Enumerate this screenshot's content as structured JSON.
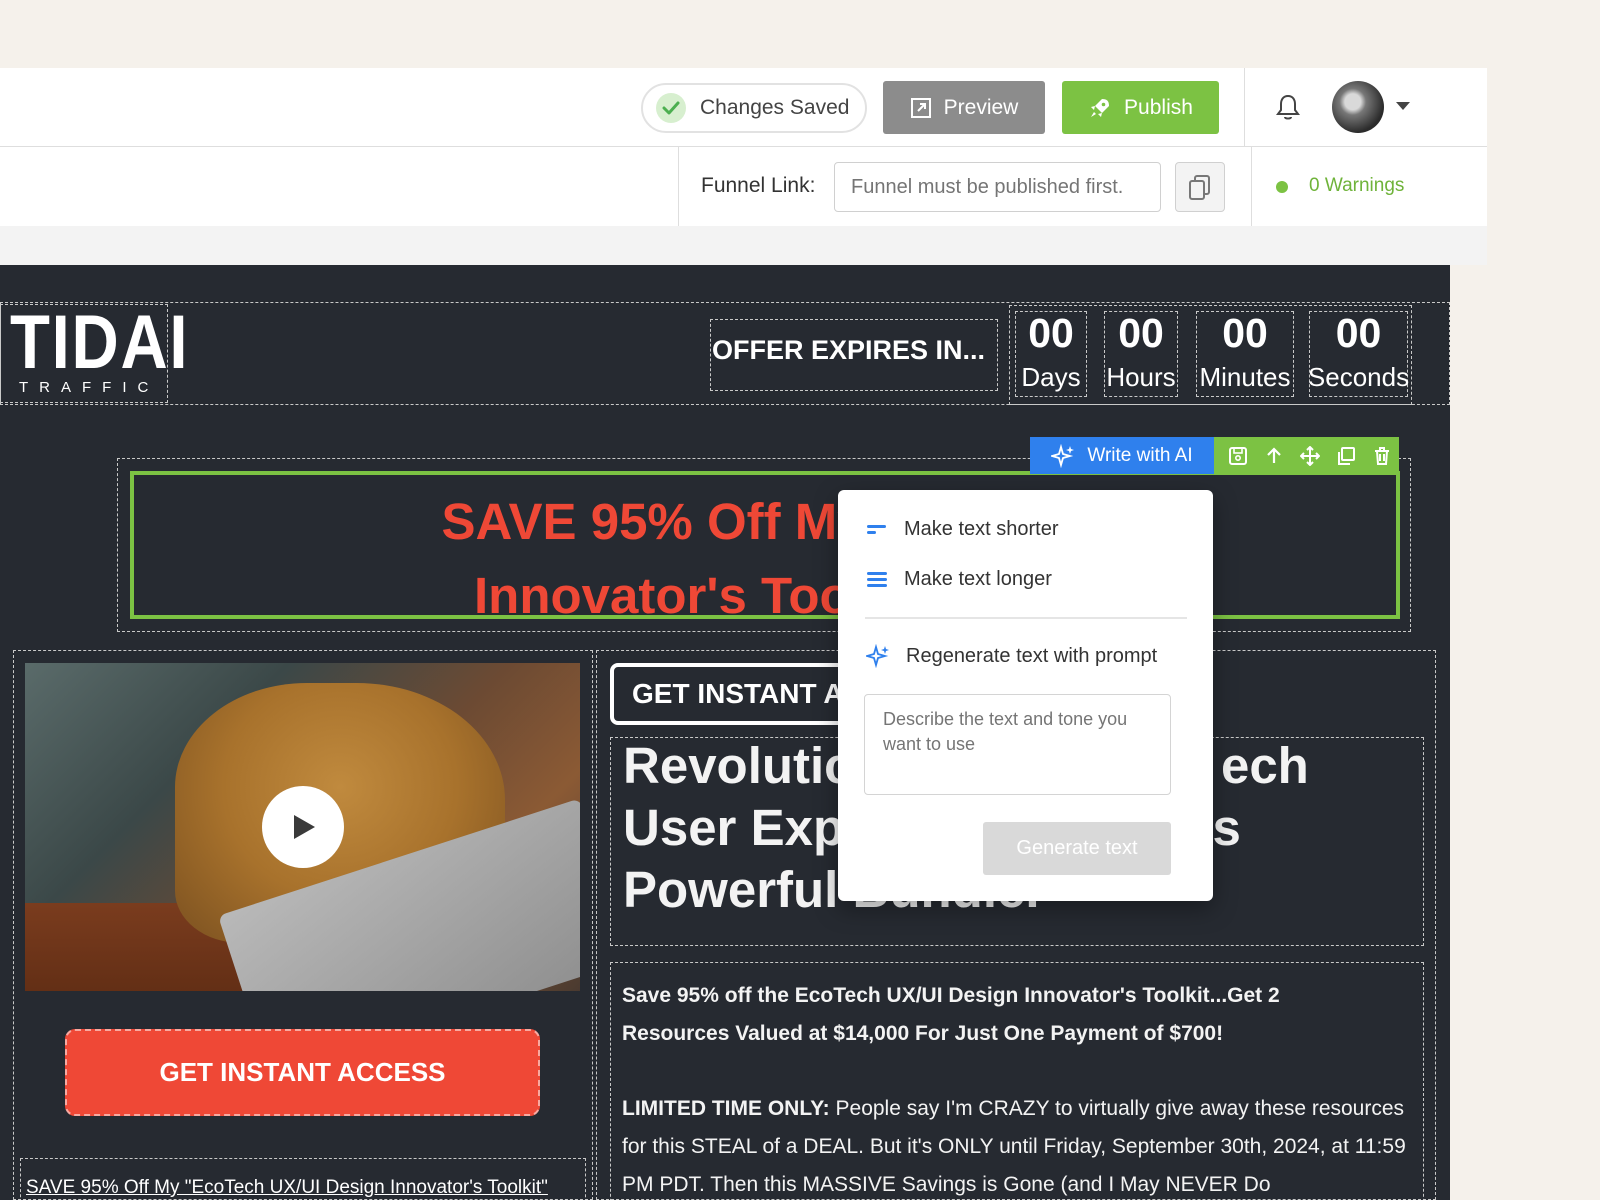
{
  "header": {
    "status": "Changes Saved",
    "preview_label": "Preview",
    "publish_label": "Publish"
  },
  "subbar": {
    "funnel_link_label": "Funnel Link:",
    "funnel_link_placeholder": "Funnel must be published first.",
    "warnings": "0 Warnings"
  },
  "page": {
    "logo_main": "TIDAI",
    "logo_sub": "TRAFFIC",
    "offer_text": "OFFER EXPIRES IN...",
    "countdown": [
      {
        "value": "00",
        "label": "Days"
      },
      {
        "value": "00",
        "label": "Hours"
      },
      {
        "value": "00",
        "label": "Minutes"
      },
      {
        "value": "00",
        "label": "Seconds"
      }
    ],
    "headline_line1": "SAVE 95% Off My EcoTech",
    "headline_line2": "Innovator's Too",
    "cta_outline": "GET INSTANT AC",
    "big_heading_line1": "Revolutic                          ech",
    "big_heading_line2": "User Expe                        s",
    "big_heading_line3": "Powerful Bundle.",
    "body_bold": "Save 95% off the EcoTech UX/UI Design Innovator's Toolkit...Get 2 Resources Valued at $14,000 For Just One Payment of $700!",
    "body_limited_label": "LIMITED TIME ONLY:",
    "body_limited_text": " People say I'm CRAZY to virtually give away these resources for this STEAL of a DEAL. But it's ONLY until Friday, September 30th, 2024, at 11:59 PM PDT. Then this MASSIVE Savings is Gone (and I May NEVER Do",
    "cta_left": "GET INSTANT ACCESS",
    "bottom_link": "SAVE 95% Off My \"EcoTech UX/UI Design Innovator's Toolkit\""
  },
  "ai_toolbar": {
    "write_label": "Write with AI"
  },
  "ai_popup": {
    "shorter": "Make text shorter",
    "longer": "Make text longer",
    "regenerate": "Regenerate text with prompt",
    "prompt_placeholder": "Describe the text and tone you want to use",
    "generate_label": "Generate text"
  },
  "colors": {
    "accent_green": "#7cc243",
    "accent_blue": "#2f80ed",
    "headline_red": "#ef4836",
    "canvas_bg": "#262a31"
  }
}
